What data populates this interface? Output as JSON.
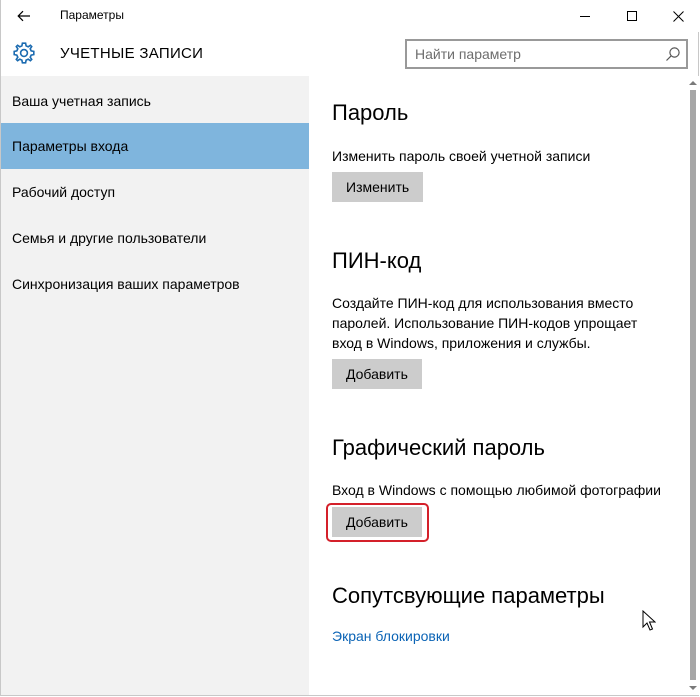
{
  "window": {
    "title": "Параметры"
  },
  "header": {
    "section_title": "УЧЕТНЫЕ ЗАПИСИ",
    "search_placeholder": "Найти параметр"
  },
  "sidebar": {
    "items": [
      {
        "label": "Ваша учетная запись",
        "active": false
      },
      {
        "label": "Параметры входа",
        "active": true
      },
      {
        "label": "Рабочий доступ",
        "active": false
      },
      {
        "label": "Семья и другие пользователи",
        "active": false
      },
      {
        "label": "Синхронизация ваших параметров",
        "active": false
      }
    ]
  },
  "main": {
    "password": {
      "heading": "Пароль",
      "description": "Изменить пароль своей учетной записи",
      "button": "Изменить"
    },
    "pin": {
      "heading": "ПИН-код",
      "description_lines": [
        "Создайте ПИН-код для использования вместо",
        "паролей. Использование ПИН-кодов упрощает",
        "вход в Windows, приложения и службы."
      ],
      "button": "Добавить"
    },
    "picture_password": {
      "heading": "Графический пароль",
      "description": "Вход в Windows с помощью любимой фотографии",
      "button": "Добавить"
    },
    "related": {
      "heading": "Сопутсвующие параметры",
      "link": "Экран блокировки"
    }
  },
  "colors": {
    "accent_selected": "#7fb5dd",
    "sidebar_bg": "#f2f2f2",
    "button_bg": "#cccccc",
    "link": "#0a63b5",
    "highlight_ring": "#d4202a"
  },
  "icons": {
    "back": "back-arrow-icon",
    "settings": "gear-icon",
    "search": "search-icon",
    "minimize": "minimize-icon",
    "maximize": "maximize-icon",
    "close": "close-icon"
  }
}
